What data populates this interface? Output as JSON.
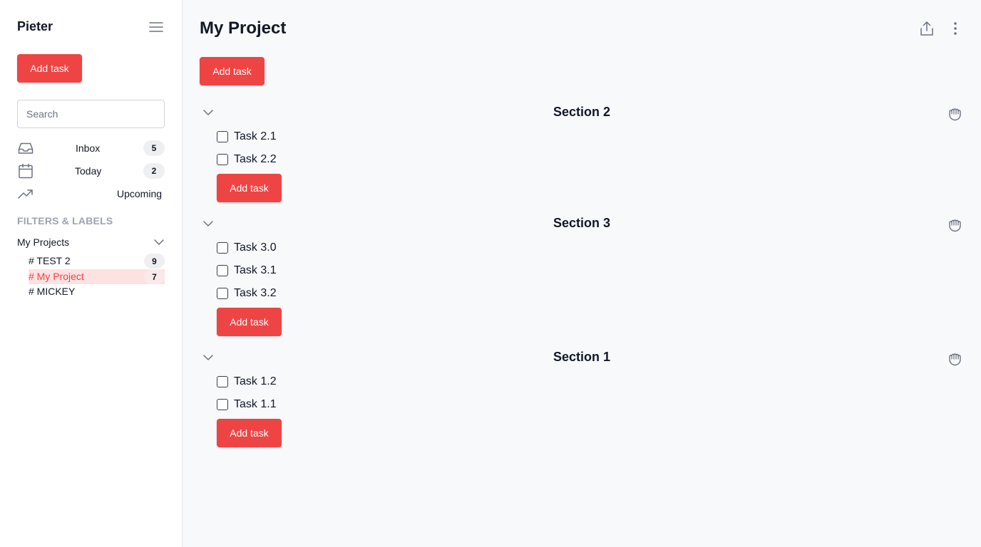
{
  "sidebar": {
    "user_name": "Pieter",
    "add_task_label": "Add task",
    "search_placeholder": "Search",
    "nav": [
      {
        "label": "Inbox",
        "count": "5",
        "icon": "inbox-icon"
      },
      {
        "label": "Today",
        "count": "2",
        "icon": "calendar-icon"
      },
      {
        "label": "Upcoming",
        "icon": "trending-up-icon"
      }
    ],
    "filters_label": "FILTERS & LABELS",
    "projects_header": "My Projects",
    "projects": [
      {
        "label": "# TEST 2",
        "count": "9"
      },
      {
        "label": "# My Project",
        "count": "7",
        "active": true
      },
      {
        "label": "# MICKEY"
      }
    ]
  },
  "main": {
    "title": "My Project",
    "add_task_label": "Add task",
    "sections": [
      {
        "title": "Section 2",
        "add_task_label": "Add task",
        "tasks": [
          "Task 2.1",
          "Task 2.2"
        ]
      },
      {
        "title": "Section 3",
        "add_task_label": "Add task",
        "tasks": [
          "Task 3.0",
          "Task 3.1",
          "Task 3.2"
        ]
      },
      {
        "title": "Section 1",
        "add_task_label": "Add task",
        "tasks": [
          "Task 1.2",
          "Task 1.1"
        ]
      }
    ]
  },
  "colors": {
    "accent": "#ef4444",
    "active_bg": "#fde2e2",
    "sidebar_bg": "#ffffff",
    "main_bg": "#f8f9fb"
  }
}
